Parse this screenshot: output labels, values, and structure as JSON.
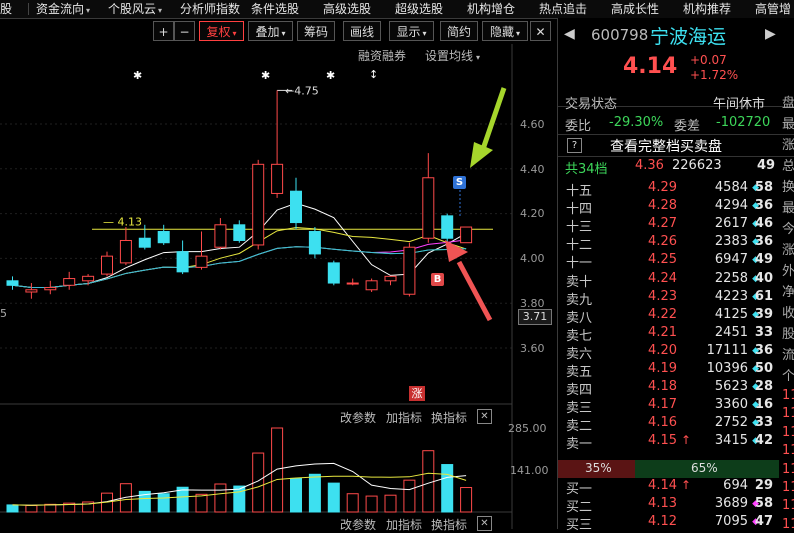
{
  "menu": {
    "items": [
      {
        "label": "资金流向",
        "dd": "▾"
      },
      {
        "label": "个股风云",
        "dd": "▾"
      },
      {
        "label": "分析师指数",
        "dd": ""
      },
      {
        "label": "条件选股",
        "dd": ""
      },
      {
        "label": "高级选股",
        "dd": ""
      },
      {
        "label": "超级选股",
        "dd": ""
      },
      {
        "label": "机构增仓",
        "dd": ""
      },
      {
        "label": "热点追击",
        "dd": ""
      },
      {
        "label": "高成长性",
        "dd": ""
      },
      {
        "label": "机构推荐",
        "dd": ""
      },
      {
        "label": "高管增",
        "dd": ""
      }
    ],
    "left_fragment": "股"
  },
  "toolbar": {
    "plus": "+",
    "minus": "−",
    "fuquan": "复权",
    "fuquan_dd": "▾",
    "diejia": "叠加",
    "diejia_dd": "▾",
    "chouma": "筹码",
    "huaxian": "画线",
    "xianshi": "显示",
    "xianshi_dd": "▾",
    "jianyue": "简约",
    "yincang": "隐藏",
    "yincang_dd": "▾",
    "close": "✕"
  },
  "chart": {
    "rzrq_label": "融资融券",
    "ma_settings": "设置均线",
    "ma_settings_dd": "▾",
    "price_ticks": [
      "4.60",
      "4.40",
      "4.20",
      "4.00",
      "3.80",
      "3.60"
    ],
    "current_price_tag": "3.71",
    "high_label": "4.75",
    "ma_label": "4.13",
    "left_fragment": "5",
    "marker_s": "S",
    "marker_b": "B",
    "zhang_badge": "涨",
    "star": "✱",
    "updown": "↕",
    "panel_labels": {
      "gaicanshu": "改参数",
      "jiazhibiao": "加指标",
      "huanzhibiao": "换指标",
      "close": "✕"
    },
    "vol_ticks": [
      "285.00",
      "141.00"
    ]
  },
  "chart_data": {
    "type": "candlestick",
    "ohlc": [
      {
        "o": 3.9,
        "h": 3.92,
        "l": 3.86,
        "c": 3.88
      },
      {
        "o": 3.85,
        "h": 3.89,
        "l": 3.82,
        "c": 3.86
      },
      {
        "o": 3.86,
        "h": 3.9,
        "l": 3.84,
        "c": 3.87
      },
      {
        "o": 3.88,
        "h": 3.94,
        "l": 3.86,
        "c": 3.91
      },
      {
        "o": 3.9,
        "h": 3.93,
        "l": 3.88,
        "c": 3.92
      },
      {
        "o": 3.93,
        "h": 4.03,
        "l": 3.92,
        "c": 4.01
      },
      {
        "o": 3.98,
        "h": 4.14,
        "l": 3.97,
        "c": 4.08
      },
      {
        "o": 4.09,
        "h": 4.15,
        "l": 4.04,
        "c": 4.05
      },
      {
        "o": 4.12,
        "h": 4.15,
        "l": 4.06,
        "c": 4.07
      },
      {
        "o": 4.03,
        "h": 4.08,
        "l": 3.93,
        "c": 3.94
      },
      {
        "o": 3.96,
        "h": 4.12,
        "l": 3.95,
        "c": 4.01
      },
      {
        "o": 4.05,
        "h": 4.18,
        "l": 4.04,
        "c": 4.15
      },
      {
        "o": 4.15,
        "h": 4.17,
        "l": 4.07,
        "c": 4.08
      },
      {
        "o": 4.06,
        "h": 4.44,
        "l": 4.04,
        "c": 4.42
      },
      {
        "o": 4.29,
        "h": 4.75,
        "l": 4.27,
        "c": 4.42
      },
      {
        "o": 4.3,
        "h": 4.36,
        "l": 4.13,
        "c": 4.16
      },
      {
        "o": 4.12,
        "h": 4.14,
        "l": 4.0,
        "c": 4.02
      },
      {
        "o": 3.98,
        "h": 3.99,
        "l": 3.88,
        "c": 3.89
      },
      {
        "o": 3.89,
        "h": 3.91,
        "l": 3.88,
        "c": 3.89
      },
      {
        "o": 3.86,
        "h": 3.91,
        "l": 3.85,
        "c": 3.9
      },
      {
        "o": 3.9,
        "h": 3.92,
        "l": 3.88,
        "c": 3.92
      },
      {
        "o": 3.84,
        "h": 4.07,
        "l": 3.83,
        "c": 4.05
      },
      {
        "o": 4.09,
        "h": 4.47,
        "l": 4.07,
        "c": 4.36
      },
      {
        "o": 4.19,
        "h": 4.2,
        "l": 4.07,
        "c": 4.09
      },
      {
        "o": 4.07,
        "h": 4.14,
        "l": 4.07,
        "c": 4.14
      }
    ],
    "volume": [
      24,
      22,
      26,
      30,
      34,
      64,
      96,
      70,
      62,
      84,
      60,
      95,
      88,
      200,
      285,
      114,
      128,
      98,
      62,
      54,
      57,
      108,
      208,
      161,
      83
    ],
    "y_range": [
      3.56,
      4.88
    ],
    "vol_range": [
      0,
      285
    ]
  },
  "quote": {
    "code": "600798",
    "name": "宁波海运",
    "price": "4.14",
    "change": "+0.07",
    "change_pct": "+1.72%",
    "status_label": "交易状态",
    "status_value": "午间休市",
    "weibi_label": "委比",
    "weibi_value": "-29.30%",
    "weicha_label": "委差",
    "weicha_value": "-102720",
    "full_book": "查看完整档买卖盘",
    "help": "?",
    "total_label": "共34档",
    "total_price": "4.36",
    "total_vol": "226623",
    "total_count": "49",
    "asks": [
      {
        "label": "十五",
        "price": "4.29",
        "vol": "4584",
        "mark": "◆",
        "count": "58"
      },
      {
        "label": "十四",
        "price": "4.28",
        "vol": "4294",
        "mark": "◆",
        "count": "36"
      },
      {
        "label": "十三",
        "price": "4.27",
        "vol": "2617",
        "mark": "◆",
        "count": "46"
      },
      {
        "label": "十二",
        "price": "4.26",
        "vol": "2383",
        "mark": "◆",
        "count": "36"
      },
      {
        "label": "十一",
        "price": "4.25",
        "vol": "6947",
        "mark": "◆",
        "count": "49"
      },
      {
        "label": "卖十",
        "price": "4.24",
        "vol": "2258",
        "mark": "◆",
        "count": "40"
      },
      {
        "label": "卖九",
        "price": "4.23",
        "vol": "4223",
        "mark": "◆",
        "count": "61"
      },
      {
        "label": "卖八",
        "price": "4.22",
        "vol": "4125",
        "mark": "◆",
        "count": "39"
      },
      {
        "label": "卖七",
        "price": "4.21",
        "vol": "2451",
        "mark": "",
        "count": "33"
      },
      {
        "label": "卖六",
        "price": "4.20",
        "vol": "17111",
        "mark": "◆",
        "count": "36"
      },
      {
        "label": "卖五",
        "price": "4.19",
        "vol": "10396",
        "mark": "◆",
        "count": "50"
      },
      {
        "label": "卖四",
        "price": "4.18",
        "vol": "5623",
        "mark": "◆",
        "count": "28"
      },
      {
        "label": "卖三",
        "price": "4.17",
        "vol": "3360",
        "mark": "◆",
        "count": "16"
      },
      {
        "label": "卖二",
        "price": "4.16",
        "vol": "2752",
        "mark": "◆",
        "count": "33"
      },
      {
        "label": "卖一",
        "price": "4.15",
        "vol": "3415",
        "mark": "◆",
        "count": "42",
        "arrow": "↑"
      }
    ],
    "ratio_sell": "35%",
    "ratio_buy": "65%",
    "bids": [
      {
        "label": "买一",
        "price": "4.14",
        "vol": "694",
        "mark": "",
        "count": "29",
        "arrow": "↑"
      },
      {
        "label": "买二",
        "price": "4.13",
        "vol": "3689",
        "mark": "◆",
        "count": "58"
      },
      {
        "label": "买三",
        "price": "4.12",
        "vol": "7095",
        "mark": "◆",
        "count": "47"
      }
    ],
    "edge_chars": [
      "盘",
      "最",
      "涨",
      "总",
      "换",
      "最",
      "今",
      "涨",
      "外",
      "净",
      "收",
      "股",
      "流",
      "个",
      "11",
      "11",
      "11",
      "11",
      "11",
      "11",
      "11",
      "11"
    ],
    "prev": "◀",
    "next": "▶"
  }
}
